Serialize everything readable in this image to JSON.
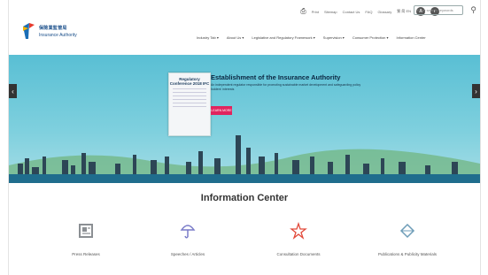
{
  "logo": {
    "cn": "保險業監管局",
    "en": "Insurance Authority"
  },
  "utility": {
    "items": [
      "Print",
      "Sitemap",
      "Contact Us",
      "FAQ",
      "Glossary"
    ],
    "lang": "繁 简 EN",
    "search_placeholder": "Enter search keywords"
  },
  "nav": {
    "items": [
      "Industry Tab ▾",
      "About Us ▾",
      "Legislative and Regulatory Framework ▾",
      "Supervision ▾",
      "Consumer Protection ▾",
      "Information Center"
    ]
  },
  "hero": {
    "poster_title": "Regulatory Conference 2018 IFC",
    "headline": "Establishment of the Insurance Authority",
    "text": "An independent regulator responsible for promoting sustainable market development and safeguarding policy holders' interests",
    "button": "LEARN MORE"
  },
  "info_center": {
    "title": "Information Center",
    "tiles": [
      {
        "label": "Press Releases",
        "icon": "newspaper-icon",
        "color": "#8b8f93"
      },
      {
        "label": "Speeches / Articles",
        "icon": "umbrella-icon",
        "color": "#7a7cc9"
      },
      {
        "label": "Consultation Documents",
        "icon": "star-icon",
        "color": "#e24a3b"
      },
      {
        "label": "Publications & Publicity Materials",
        "icon": "diamond-icon",
        "color": "#6e9db8"
      }
    ]
  },
  "colors": {
    "accent": "#e0245e",
    "hero_sky": "#59bfd4",
    "brand": "#1a4f8a"
  }
}
